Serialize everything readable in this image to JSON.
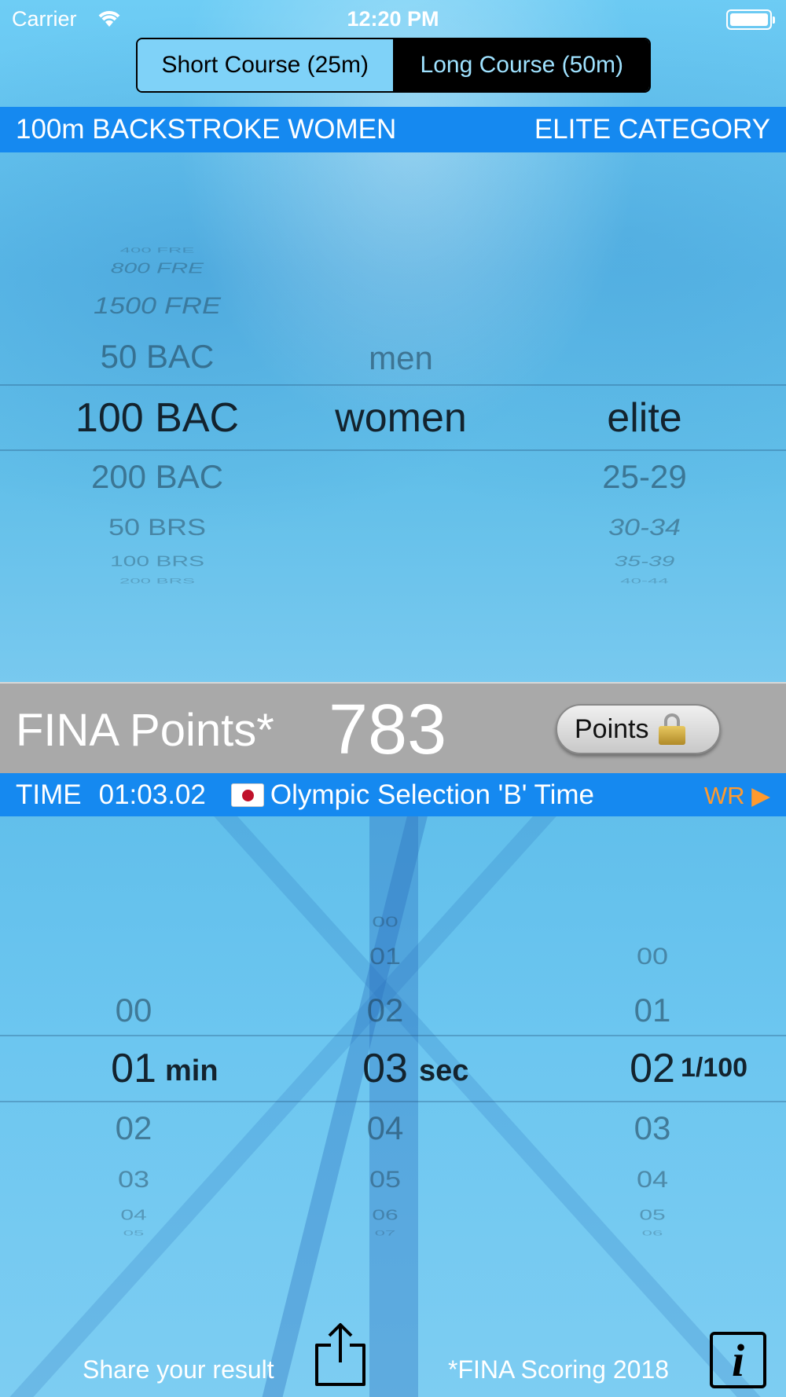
{
  "status_bar": {
    "carrier": "Carrier",
    "time": "12:20 PM"
  },
  "course_selector": {
    "options": [
      "Short Course (25m)",
      "Long Course (50m)"
    ],
    "selected": "Long Course (50m)"
  },
  "event_header": {
    "event": "100m BACKSTROKE WOMEN",
    "category": "ELITE CATEGORY"
  },
  "event_picker": {
    "strokes": {
      "above": [
        "400 FRE",
        "800 FRE",
        "1500 FRE",
        "50 BAC"
      ],
      "selected": "100 BAC",
      "below": [
        "200 BAC",
        "50 BRS",
        "100 BRS",
        "200 BRS"
      ]
    },
    "gender": {
      "above": [
        "men"
      ],
      "selected": "women",
      "below": []
    },
    "category": {
      "above": [],
      "selected": "elite",
      "below": [
        "25-29",
        "30-34",
        "35-39",
        "40-44"
      ]
    }
  },
  "points": {
    "label": "FINA Points*",
    "value": "783",
    "button_label": "Points",
    "button_icon": "lock-icon"
  },
  "time_bar": {
    "label": "TIME",
    "value": "01:03.02",
    "flag": "japan-flag-icon",
    "qualification": "Olympic Selection 'B' Time",
    "wr_link": "WR ▶"
  },
  "time_picker": {
    "minutes": {
      "above": [
        "00"
      ],
      "selected": "01",
      "below": [
        "02",
        "03",
        "04",
        "05"
      ],
      "unit": "min"
    },
    "seconds": {
      "above": [
        "00",
        "01",
        "02"
      ],
      "selected": "03",
      "below": [
        "04",
        "05",
        "06",
        "07"
      ],
      "unit": "sec"
    },
    "hundredths": {
      "above": [
        "00",
        "01"
      ],
      "selected": "02",
      "below": [
        "03",
        "04",
        "05",
        "06"
      ],
      "unit": "1/100"
    }
  },
  "footer": {
    "share_label": "Share your result",
    "scoring_label": "*FINA Scoring 2018",
    "info_label": "i"
  },
  "colors": {
    "accent_bar": "#1589f0",
    "points_bg": "#a9a9a9",
    "wr_link": "#ff9a2e"
  }
}
